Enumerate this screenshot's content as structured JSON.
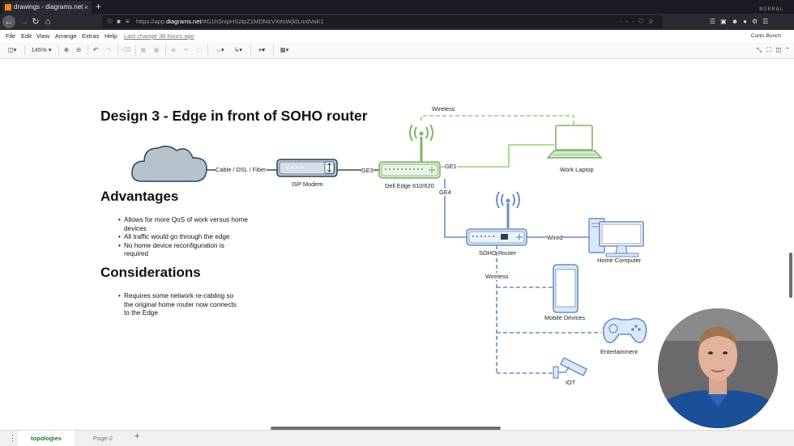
{
  "browser": {
    "tab_title": "drawings - diagrams.net",
    "tab_close": "×",
    "new_tab": "+",
    "url_prefix": "https://app.",
    "url_host": "diagrams.net",
    "url_rest": "/#G1hSnipHSztpZ1MDMzVXesWjktLmdVaK1",
    "mode_badge": "NORMAL"
  },
  "menubar": {
    "items": [
      "File",
      "Edit",
      "View",
      "Arrange",
      "Extras",
      "Help"
    ],
    "last_change": "Last change 38 hours ago",
    "user": "Curtis Bunch"
  },
  "toolbar": {
    "zoom": "145%"
  },
  "diagram": {
    "title": "Design 3 - Edge in front of SOHO router",
    "advantages_heading": "Advantages",
    "advantages": [
      "Allows for more QoS of work versus home devices",
      "All traffic would go through the edge",
      "No home device reconfiguration is required"
    ],
    "considerations_heading": "Considerations",
    "considerations": [
      "Requires some network re-cabling so the original home router now connects to the Edge"
    ],
    "labels": {
      "cable": "Cable / DSL / Fiber",
      "isp_modem": "ISP Modem",
      "ge3": "GE3",
      "dell_edge": "Dell Edge 610/620",
      "ge1": "GE1",
      "ge4": "GE4",
      "wireless_top": "Wireless",
      "work_laptop": "Work Laptop",
      "soho_router": "SOHO Router",
      "wired": "Wired",
      "home_computer": "Home Computer",
      "wireless_mid": "Wireless",
      "mobile_devices": "Mobile Devices",
      "entertainment": "Entertainment",
      "iot": "IOT"
    },
    "colors": {
      "cloud": "#b6c2cb",
      "modem": "#b9c8d6",
      "edge_green": "#d5e8d4",
      "edge_stroke": "#82b366",
      "blue_stroke": "#6c8ebf",
      "blue_fill": "#dae8fc"
    }
  },
  "pages": {
    "active": "topologies",
    "other": "Page-2",
    "add": "+"
  }
}
